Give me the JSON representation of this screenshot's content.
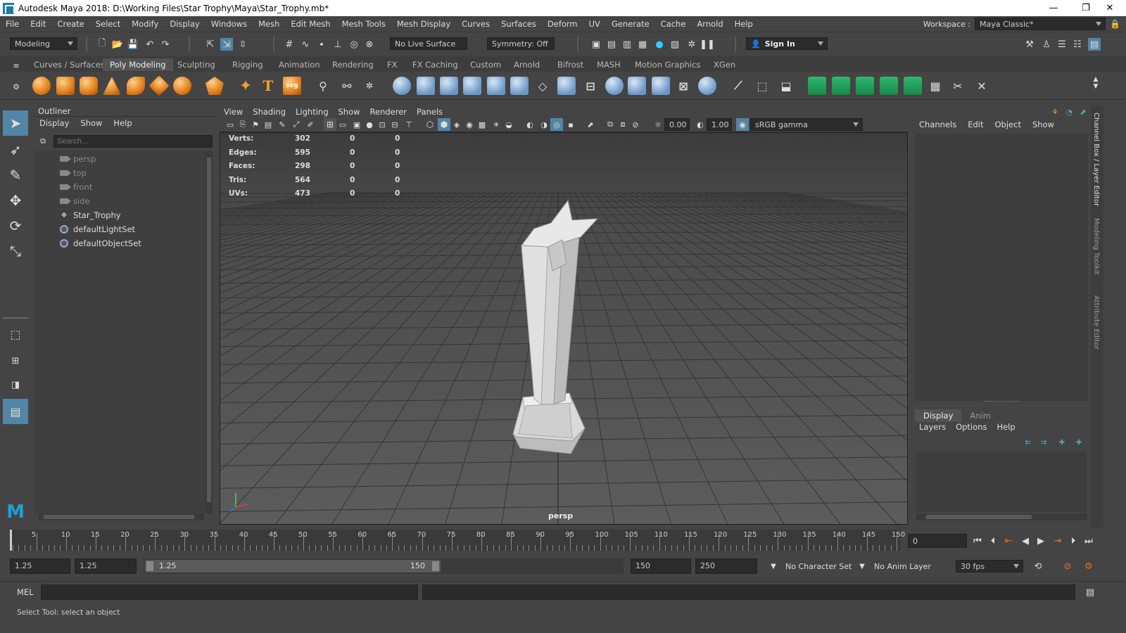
{
  "window": {
    "title": "Autodesk Maya 2018: D:\\Working Files\\Star Trophy\\Maya\\Star_Trophy.mb*",
    "controls": [
      "—",
      "❐",
      "✕"
    ]
  },
  "menubar": {
    "items": [
      "File",
      "Edit",
      "Create",
      "Select",
      "Modify",
      "Display",
      "Windows",
      "Mesh",
      "Edit Mesh",
      "Mesh Tools",
      "Mesh Display",
      "Curves",
      "Surfaces",
      "Deform",
      "UV",
      "Generate",
      "Cache",
      "Arnold",
      "Help"
    ],
    "workspace_label": "Workspace :",
    "workspace_value": "Maya Classic*"
  },
  "statusline": {
    "menuset": "Modeling",
    "live_surface": "No Live Surface",
    "symmetry": "Symmetry: Off",
    "sign_in": "Sign In"
  },
  "shelf": {
    "tabs": [
      "Curves / Surfaces",
      "Poly Modeling",
      "Sculpting",
      "Rigging",
      "Animation",
      "Rendering",
      "FX",
      "FX Caching",
      "Custom",
      "Arnold",
      "Bifrost",
      "MASH",
      "Motion Graphics",
      "XGen"
    ],
    "active_tab": "Poly Modeling"
  },
  "outliner": {
    "title": "Outliner",
    "menus": [
      "Display",
      "Show",
      "Help"
    ],
    "search_placeholder": "Search...",
    "items": [
      {
        "label": "persp",
        "type": "camera",
        "dim": true
      },
      {
        "label": "top",
        "type": "camera",
        "dim": true
      },
      {
        "label": "front",
        "type": "camera",
        "dim": true
      },
      {
        "label": "side",
        "type": "camera",
        "dim": true
      },
      {
        "label": "Star_Trophy",
        "type": "mesh",
        "dim": false
      },
      {
        "label": "defaultLightSet",
        "type": "set",
        "dim": false
      },
      {
        "label": "defaultObjectSet",
        "type": "set",
        "dim": false
      }
    ]
  },
  "viewport": {
    "menus": [
      "View",
      "Shading",
      "Lighting",
      "Show",
      "Renderer",
      "Panels"
    ],
    "near_value": "0.00",
    "far_value": "1.00",
    "color_space": "sRGB gamma",
    "camera_label": "persp",
    "hud": [
      {
        "label": "Verts:",
        "a": "302",
        "b": "0",
        "c": "0"
      },
      {
        "label": "Edges:",
        "a": "595",
        "b": "0",
        "c": "0"
      },
      {
        "label": "Faces:",
        "a": "298",
        "b": "0",
        "c": "0"
      },
      {
        "label": "Tris:",
        "a": "564",
        "b": "0",
        "c": "0"
      },
      {
        "label": "UVs:",
        "a": "473",
        "b": "0",
        "c": "0"
      }
    ]
  },
  "channelbox": {
    "menus": [
      "Channels",
      "Edit",
      "Object",
      "Show"
    ],
    "layer_tabs": [
      "Display",
      "Anim"
    ],
    "layer_menus": [
      "Layers",
      "Options",
      "Help"
    ],
    "side_tabs": [
      "Channel Box / Layer Editor",
      "Modeling Toolkit",
      "Attribute Editor"
    ]
  },
  "timeline": {
    "ticks": [
      "5",
      "10",
      "15",
      "20",
      "25",
      "30",
      "35",
      "40",
      "45",
      "50",
      "55",
      "60",
      "65",
      "70",
      "75",
      "80",
      "85",
      "90",
      "95",
      "100",
      "105",
      "110",
      "115",
      "120",
      "125",
      "130",
      "135",
      "140",
      "145",
      "150"
    ],
    "current_frame": "0"
  },
  "range": {
    "start": "1.25",
    "playback_start": "1.25",
    "slider_start": "1.25",
    "slider_end": "150",
    "playback_end": "150",
    "end": "250",
    "character_set": "No Character Set",
    "anim_layer": "No Anim Layer",
    "fps": "30 fps"
  },
  "cmdline": {
    "label": "MEL"
  },
  "helpline": {
    "text": "Select Tool: select an object"
  }
}
